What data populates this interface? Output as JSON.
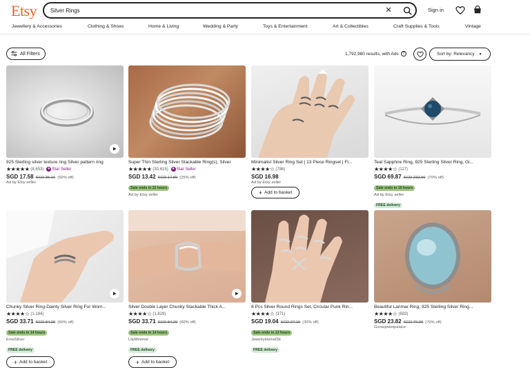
{
  "header": {
    "logo": "Etsy",
    "search": {
      "value": "Silver Rings"
    },
    "sign_in": "Sign in"
  },
  "nav": [
    "Jewellery & Accessories",
    "Clothing & Shoes",
    "Home & Living",
    "Wedding & Party",
    "Toys & Entertainment",
    "Art & Collectibles",
    "Craft Supplies & Tools",
    "Vintage"
  ],
  "toolbar": {
    "filters_label": "All Filters",
    "results_text": "1,792,980 results, with Ads",
    "sort_label": "Sort by: Relevancy"
  },
  "listings": [
    {
      "title": "925 Sterling silver texture ring Silver pattern ring",
      "stars": "★★★★★",
      "reviews": "(8,653)",
      "star_seller": "Star Seller",
      "price": "SGD 17.58",
      "original": "SGD 35.16",
      "discount": "(50% off)",
      "seller": "Ad by Etsy seller"
    },
    {
      "title": "Super Thin Sterling Silver Stackable Ring(s), Silver",
      "stars": "★★★★★",
      "reviews": "(30,615)",
      "star_seller": "Star Seller",
      "price": "SGD 13.42",
      "original": "SGD 17.89",
      "discount": "(25% off)",
      "sale": "Sale ends in 22 hours",
      "seller": "Ad by Etsy seller"
    },
    {
      "title": "Minimalist Silver Ring Set | 13 Piece Ringset | Fl...",
      "stars": "★★★★☆",
      "reviews": "(786)",
      "price": "SGD 16.98",
      "seller": "Ad by Etsy seller",
      "add_to_basket": "Add to basket"
    },
    {
      "title": "Teal Sapphire Ring, 925 Sterling Silver Ring, Gi...",
      "stars": "★★★★☆",
      "reviews": "(117)",
      "price": "SGD 69.87",
      "original": "SGD 232.90",
      "discount": "(70% off)",
      "sale": "Sale ends in 10 hours",
      "seller": "Ad by Etsy seller",
      "free_delivery": "FREE delivery"
    },
    {
      "title": "Chunky Silver Ring-Dainty Silver Ring For Wom...",
      "stars": "★★★★☆",
      "reviews": "(1,184)",
      "price": "SGD 33.71",
      "original": "SGD 84.29",
      "discount": "(60% off)",
      "sale": "Sale ends in 14 hours",
      "seller": "ErosSilver",
      "free_delivery": "FREE delivery",
      "add_to_basket": "Add to basket"
    },
    {
      "title": "Silver Double Layer Chunky Stackable Thick A...",
      "stars": "★★★★☆",
      "reviews": "(1,829)",
      "price": "SGD 33.71",
      "original": "SGD 84.29",
      "discount": "(60% off)",
      "sale": "Sale ends in 14 hours",
      "seller": "LilyMinimal",
      "free_delivery": "FREE delivery",
      "add_to_basket": "Add to basket"
    },
    {
      "title": "8 Pcs Silver Round Rings Set, Circular Punk Rin...",
      "stars": "★★★★☆",
      "reviews": "(371)",
      "price": "SGD 19.04",
      "original": "SGD 27.19",
      "discount": "(30% off)",
      "sale": "Sale ends in 13 hours",
      "seller": "JewelryHomeDE",
      "free_delivery": "FREE delivery"
    },
    {
      "title": "Beautiful Larimar Ring, 925 Sterling Silver Ring...",
      "stars": "★★★★☆",
      "reviews": "(683)",
      "price": "SGD 23.82",
      "original": "SGD 79.39",
      "discount": "(70% off)",
      "seller": "Goravjewelpalace"
    }
  ],
  "colors": {
    "brand": "#f1641e",
    "star_seller": "#7f187f",
    "sale_badge": "#9ec27f",
    "free_badge": "#d4e9d7"
  }
}
